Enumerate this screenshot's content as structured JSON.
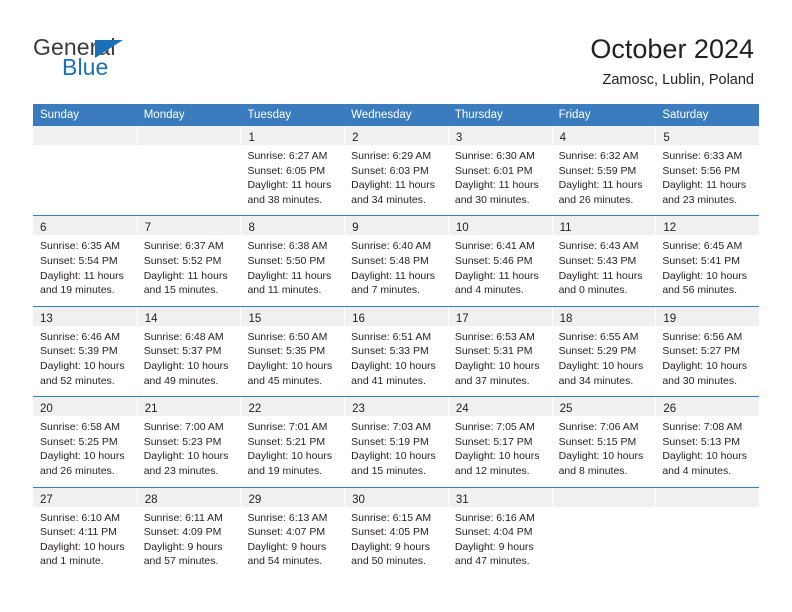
{
  "brand": {
    "word1": "General",
    "word2": "Blue",
    "triangle_color": "#1b70b8"
  },
  "header": {
    "title": "October 2024",
    "subtitle": "Zamosc, Lublin, Poland",
    "accent_color": "#3a7cbd",
    "daynum_band_color": "#f0f0f0"
  },
  "weekdays": [
    "Sunday",
    "Monday",
    "Tuesday",
    "Wednesday",
    "Thursday",
    "Friday",
    "Saturday"
  ],
  "labels": {
    "sunrise_prefix": "Sunrise:",
    "sunset_prefix": "Sunset:",
    "daylight_prefix": "Daylight:"
  },
  "weeks": [
    [
      {
        "day": "",
        "empty": true
      },
      {
        "day": "",
        "empty": true
      },
      {
        "day": "1",
        "sunrise": "Sunrise: 6:27 AM",
        "sunset": "Sunset: 6:05 PM",
        "daylight_line1": "Daylight: 11 hours",
        "daylight_line2": "and 38 minutes."
      },
      {
        "day": "2",
        "sunrise": "Sunrise: 6:29 AM",
        "sunset": "Sunset: 6:03 PM",
        "daylight_line1": "Daylight: 11 hours",
        "daylight_line2": "and 34 minutes."
      },
      {
        "day": "3",
        "sunrise": "Sunrise: 6:30 AM",
        "sunset": "Sunset: 6:01 PM",
        "daylight_line1": "Daylight: 11 hours",
        "daylight_line2": "and 30 minutes."
      },
      {
        "day": "4",
        "sunrise": "Sunrise: 6:32 AM",
        "sunset": "Sunset: 5:59 PM",
        "daylight_line1": "Daylight: 11 hours",
        "daylight_line2": "and 26 minutes."
      },
      {
        "day": "5",
        "sunrise": "Sunrise: 6:33 AM",
        "sunset": "Sunset: 5:56 PM",
        "daylight_line1": "Daylight: 11 hours",
        "daylight_line2": "and 23 minutes."
      }
    ],
    [
      {
        "day": "6",
        "sunrise": "Sunrise: 6:35 AM",
        "sunset": "Sunset: 5:54 PM",
        "daylight_line1": "Daylight: 11 hours",
        "daylight_line2": "and 19 minutes."
      },
      {
        "day": "7",
        "sunrise": "Sunrise: 6:37 AM",
        "sunset": "Sunset: 5:52 PM",
        "daylight_line1": "Daylight: 11 hours",
        "daylight_line2": "and 15 minutes."
      },
      {
        "day": "8",
        "sunrise": "Sunrise: 6:38 AM",
        "sunset": "Sunset: 5:50 PM",
        "daylight_line1": "Daylight: 11 hours",
        "daylight_line2": "and 11 minutes."
      },
      {
        "day": "9",
        "sunrise": "Sunrise: 6:40 AM",
        "sunset": "Sunset: 5:48 PM",
        "daylight_line1": "Daylight: 11 hours",
        "daylight_line2": "and 7 minutes."
      },
      {
        "day": "10",
        "sunrise": "Sunrise: 6:41 AM",
        "sunset": "Sunset: 5:46 PM",
        "daylight_line1": "Daylight: 11 hours",
        "daylight_line2": "and 4 minutes."
      },
      {
        "day": "11",
        "sunrise": "Sunrise: 6:43 AM",
        "sunset": "Sunset: 5:43 PM",
        "daylight_line1": "Daylight: 11 hours",
        "daylight_line2": "and 0 minutes."
      },
      {
        "day": "12",
        "sunrise": "Sunrise: 6:45 AM",
        "sunset": "Sunset: 5:41 PM",
        "daylight_line1": "Daylight: 10 hours",
        "daylight_line2": "and 56 minutes."
      }
    ],
    [
      {
        "day": "13",
        "sunrise": "Sunrise: 6:46 AM",
        "sunset": "Sunset: 5:39 PM",
        "daylight_line1": "Daylight: 10 hours",
        "daylight_line2": "and 52 minutes."
      },
      {
        "day": "14",
        "sunrise": "Sunrise: 6:48 AM",
        "sunset": "Sunset: 5:37 PM",
        "daylight_line1": "Daylight: 10 hours",
        "daylight_line2": "and 49 minutes."
      },
      {
        "day": "15",
        "sunrise": "Sunrise: 6:50 AM",
        "sunset": "Sunset: 5:35 PM",
        "daylight_line1": "Daylight: 10 hours",
        "daylight_line2": "and 45 minutes."
      },
      {
        "day": "16",
        "sunrise": "Sunrise: 6:51 AM",
        "sunset": "Sunset: 5:33 PM",
        "daylight_line1": "Daylight: 10 hours",
        "daylight_line2": "and 41 minutes."
      },
      {
        "day": "17",
        "sunrise": "Sunrise: 6:53 AM",
        "sunset": "Sunset: 5:31 PM",
        "daylight_line1": "Daylight: 10 hours",
        "daylight_line2": "and 37 minutes."
      },
      {
        "day": "18",
        "sunrise": "Sunrise: 6:55 AM",
        "sunset": "Sunset: 5:29 PM",
        "daylight_line1": "Daylight: 10 hours",
        "daylight_line2": "and 34 minutes."
      },
      {
        "day": "19",
        "sunrise": "Sunrise: 6:56 AM",
        "sunset": "Sunset: 5:27 PM",
        "daylight_line1": "Daylight: 10 hours",
        "daylight_line2": "and 30 minutes."
      }
    ],
    [
      {
        "day": "20",
        "sunrise": "Sunrise: 6:58 AM",
        "sunset": "Sunset: 5:25 PM",
        "daylight_line1": "Daylight: 10 hours",
        "daylight_line2": "and 26 minutes."
      },
      {
        "day": "21",
        "sunrise": "Sunrise: 7:00 AM",
        "sunset": "Sunset: 5:23 PM",
        "daylight_line1": "Daylight: 10 hours",
        "daylight_line2": "and 23 minutes."
      },
      {
        "day": "22",
        "sunrise": "Sunrise: 7:01 AM",
        "sunset": "Sunset: 5:21 PM",
        "daylight_line1": "Daylight: 10 hours",
        "daylight_line2": "and 19 minutes."
      },
      {
        "day": "23",
        "sunrise": "Sunrise: 7:03 AM",
        "sunset": "Sunset: 5:19 PM",
        "daylight_line1": "Daylight: 10 hours",
        "daylight_line2": "and 15 minutes."
      },
      {
        "day": "24",
        "sunrise": "Sunrise: 7:05 AM",
        "sunset": "Sunset: 5:17 PM",
        "daylight_line1": "Daylight: 10 hours",
        "daylight_line2": "and 12 minutes."
      },
      {
        "day": "25",
        "sunrise": "Sunrise: 7:06 AM",
        "sunset": "Sunset: 5:15 PM",
        "daylight_line1": "Daylight: 10 hours",
        "daylight_line2": "and 8 minutes."
      },
      {
        "day": "26",
        "sunrise": "Sunrise: 7:08 AM",
        "sunset": "Sunset: 5:13 PM",
        "daylight_line1": "Daylight: 10 hours",
        "daylight_line2": "and 4 minutes."
      }
    ],
    [
      {
        "day": "27",
        "sunrise": "Sunrise: 6:10 AM",
        "sunset": "Sunset: 4:11 PM",
        "daylight_line1": "Daylight: 10 hours",
        "daylight_line2": "and 1 minute."
      },
      {
        "day": "28",
        "sunrise": "Sunrise: 6:11 AM",
        "sunset": "Sunset: 4:09 PM",
        "daylight_line1": "Daylight: 9 hours",
        "daylight_line2": "and 57 minutes."
      },
      {
        "day": "29",
        "sunrise": "Sunrise: 6:13 AM",
        "sunset": "Sunset: 4:07 PM",
        "daylight_line1": "Daylight: 9 hours",
        "daylight_line2": "and 54 minutes."
      },
      {
        "day": "30",
        "sunrise": "Sunrise: 6:15 AM",
        "sunset": "Sunset: 4:05 PM",
        "daylight_line1": "Daylight: 9 hours",
        "daylight_line2": "and 50 minutes."
      },
      {
        "day": "31",
        "sunrise": "Sunrise: 6:16 AM",
        "sunset": "Sunset: 4:04 PM",
        "daylight_line1": "Daylight: 9 hours",
        "daylight_line2": "and 47 minutes."
      },
      {
        "day": "",
        "empty": true
      },
      {
        "day": "",
        "empty": true
      }
    ]
  ]
}
